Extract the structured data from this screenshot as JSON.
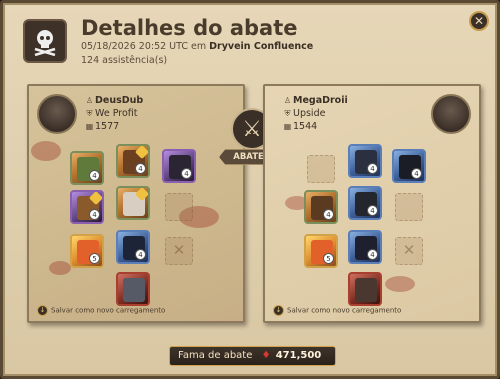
{
  "header": {
    "title": "Detalhes do abate",
    "datetime": "05/18/2026 20:52 UTC em",
    "location": "Dryvein Confluence",
    "assists": "124 assistência(s)"
  },
  "center": {
    "icon": "crossed-swords-icon",
    "label": "ABATEU"
  },
  "killer": {
    "name": "DeusDub",
    "guild": "We Profit",
    "item_power": "1577",
    "save_label": "Salvar como novo carregamento",
    "slots": [
      {
        "slot": "bag",
        "quality": "",
        "level": "4",
        "icon": "bag-icon"
      },
      {
        "slot": "head",
        "quality": "",
        "level": "4",
        "icon": "helmet-icon"
      },
      {
        "slot": "cape",
        "quality": "",
        "level": "4",
        "icon": "cape-icon"
      },
      {
        "slot": "main-hand",
        "quality": "",
        "level": "4",
        "icon": "crossbow-icon"
      },
      {
        "slot": "chest",
        "quality": "",
        "level": "",
        "icon": "armor-icon"
      },
      {
        "slot": "off-hand",
        "quality": "",
        "level": "",
        "icon": "offhand-icon"
      },
      {
        "slot": "potion",
        "quality": "",
        "level": "5",
        "icon": "potion-icon"
      },
      {
        "slot": "shoes",
        "quality": "",
        "level": "4",
        "icon": "shoes-icon"
      },
      {
        "slot": "food",
        "quality": "",
        "level": "",
        "icon": "food-icon"
      },
      {
        "slot": "mount",
        "quality": "",
        "level": "",
        "icon": "mount-icon"
      }
    ]
  },
  "victim": {
    "name": "MegaDroii",
    "guild": "Upside",
    "item_power": "1544",
    "save_label": "Salvar como novo carregamento",
    "slots": [
      {
        "slot": "bag",
        "quality": "",
        "level": "",
        "icon": "bag-icon"
      },
      {
        "slot": "head",
        "quality": "",
        "level": "4",
        "icon": "helmet-icon"
      },
      {
        "slot": "cape",
        "quality": "",
        "level": "4",
        "icon": "cape-icon"
      },
      {
        "slot": "main-hand",
        "quality": "",
        "level": "4",
        "icon": "crossbow-icon"
      },
      {
        "slot": "chest",
        "quality": "",
        "level": "4",
        "icon": "armor-icon"
      },
      {
        "slot": "off-hand",
        "quality": "",
        "level": "",
        "icon": "offhand-icon"
      },
      {
        "slot": "potion",
        "quality": "",
        "level": "5",
        "icon": "potion-icon"
      },
      {
        "slot": "shoes",
        "quality": "",
        "level": "4",
        "icon": "shoes-icon"
      },
      {
        "slot": "food",
        "quality": "",
        "level": "",
        "icon": "food-icon"
      },
      {
        "slot": "mount",
        "quality": "",
        "level": "",
        "icon": "mount-icon"
      }
    ]
  },
  "fame": {
    "label": "Fama de abate",
    "icon": "fame-gem-icon",
    "value": "471,500"
  },
  "colors": {
    "accent": "#d2a24a",
    "fame_icon": "#d9382d",
    "text": "#4a3c2d"
  }
}
